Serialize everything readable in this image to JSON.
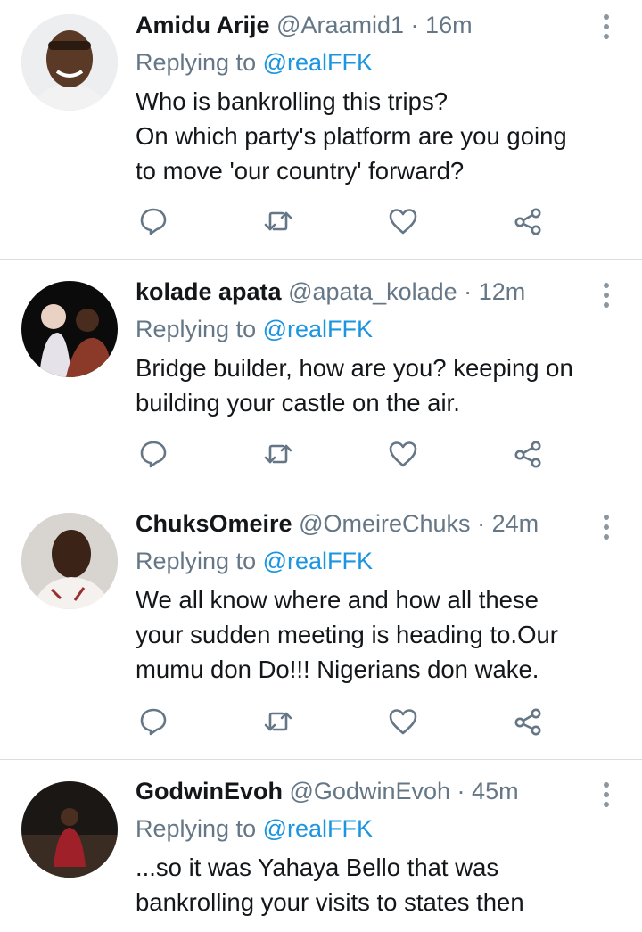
{
  "replying_label": "Replying to",
  "tweets": [
    {
      "name": "Amidu Arije",
      "handle": "@Araamid1",
      "separator": "·",
      "time": "16m",
      "mention": "@realFFK",
      "lines": [
        "Who is bankrolling this trips?",
        "On which party's platform are you going",
        "to move 'our country' forward?"
      ]
    },
    {
      "name": "kolade apata",
      "handle": "@apata_kolade",
      "separator": "·",
      "time": "12m",
      "mention": "@realFFK",
      "lines": [
        "Bridge builder, how are you?  keeping on",
        "building your castle on the air."
      ]
    },
    {
      "name": "ChuksOmeire",
      "handle": "@OmeireChuks",
      "separator": "·",
      "time": "24m",
      "mention": "@realFFK",
      "lines": [
        "We all know where and how all these",
        "your sudden meeting is heading to.Our",
        "mumu don Do!!! Nigerians don wake."
      ]
    },
    {
      "name": "GodwinEvoh",
      "handle": "@GodwinEvoh",
      "separator": "·",
      "time": "45m",
      "mention": "@realFFK",
      "lines": [
        "...so it was Yahaya Bello that was",
        "bankrolling your visits to states then"
      ]
    }
  ],
  "action_icons": [
    "reply-icon",
    "retweet-icon",
    "like-icon",
    "share-icon"
  ],
  "colors": {
    "link": "#1b95e0",
    "muted": "#657786",
    "text": "#14171a",
    "icon": "#657786",
    "divider": "#d9dde0"
  }
}
